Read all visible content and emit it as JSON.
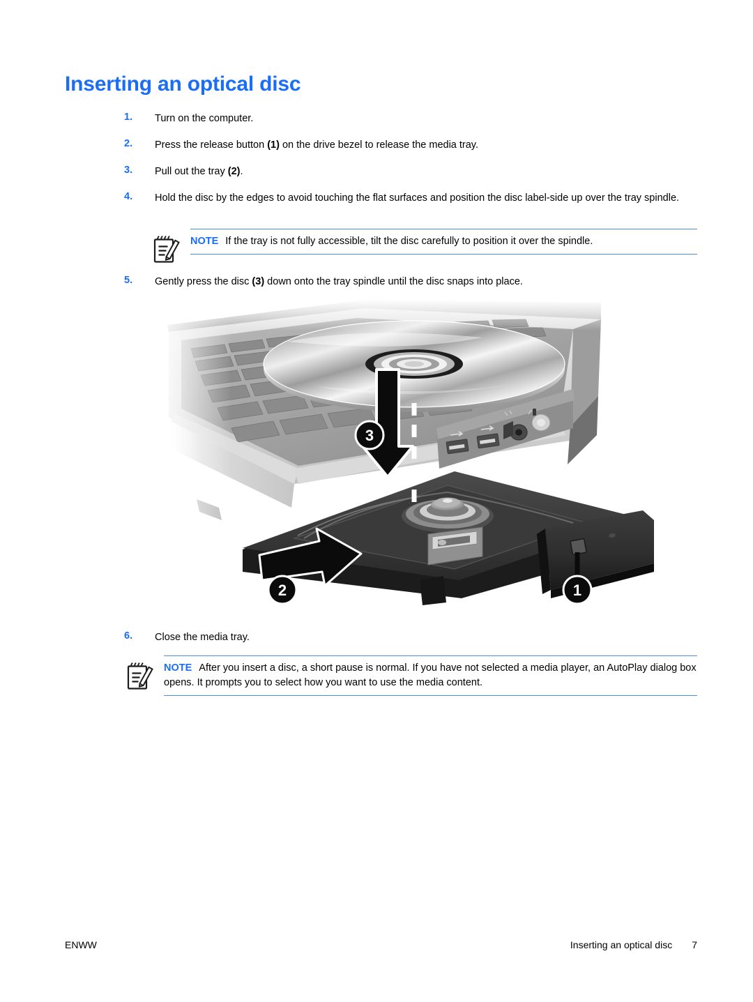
{
  "document": {
    "title": "Inserting an optical disc",
    "title_color": "#1a6ef5"
  },
  "steps": [
    {
      "num": "1.",
      "text": "Turn on the computer."
    },
    {
      "num": "2.",
      "text_a": "Press the release button ",
      "bold": "(1)",
      "text_b": " on the drive bezel to release the media tray."
    },
    {
      "num": "3.",
      "text_a": "Pull out the tray ",
      "bold": "(2)",
      "text_b": "."
    },
    {
      "num": "4.",
      "text": "Hold the disc by the edges to avoid touching the flat surfaces and position the disc label-side up over the tray spindle."
    },
    {
      "num": "5.",
      "text_a": "Gently press the disc ",
      "bold": "(3)",
      "text_b": " down onto the tray spindle until the disc snaps into place."
    },
    {
      "num": "6.",
      "text": "Close the media tray."
    }
  ],
  "notes": [
    {
      "icon": "note-pencil-icon",
      "label": "NOTE",
      "text": "If the tray is not fully accessible, tilt the disc carefully to position it over the spindle."
    },
    {
      "icon": "note-pencil-icon",
      "label": "NOTE",
      "text": "After you insert a disc, a short pause is normal. If you have not selected a media player, an AutoPlay dialog box opens. It prompts you to select how you want to use the media content."
    }
  ],
  "figure": {
    "alt": "Laptop with optical drive media tray open, disc held above the tray spindle",
    "callouts": [
      {
        "id": "1",
        "label": "1",
        "meaning": "release button on drive bezel"
      },
      {
        "id": "2",
        "label": "2",
        "meaning": "pull out the tray"
      },
      {
        "id": "3",
        "label": "3",
        "meaning": "press the disc down onto spindle"
      }
    ]
  },
  "footer": {
    "left": "ENWW",
    "right_title": "Inserting an optical disc",
    "page_number": "7"
  }
}
